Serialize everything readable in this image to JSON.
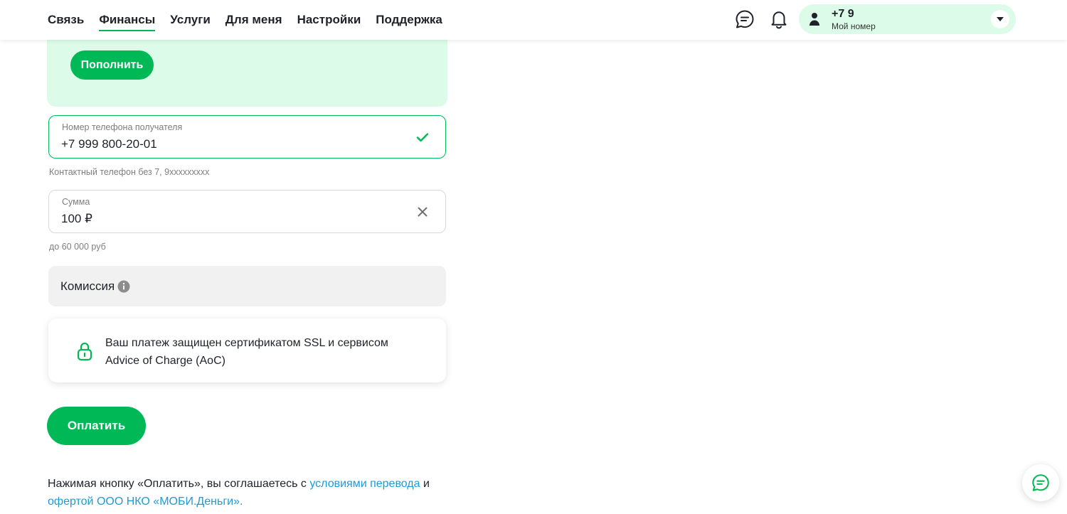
{
  "nav": {
    "items": [
      {
        "label": "Связь"
      },
      {
        "label": "Финансы",
        "active": true
      },
      {
        "label": "Услуги"
      },
      {
        "label": "Для меня"
      },
      {
        "label": "Настройки"
      },
      {
        "label": "Поддержка"
      }
    ],
    "icons": [
      "chat-icon",
      "bell-icon"
    ]
  },
  "account": {
    "number": "+7 9",
    "label": "Мой номер"
  },
  "topup": {
    "button_label": "Пополнить"
  },
  "phone_field": {
    "label": "Номер телефона получателя",
    "value": "+7 999 800-20-01",
    "status_icon": "check-icon",
    "hint": "Контактный телефон без 7, 9xxxxxxxxx"
  },
  "amount_field": {
    "label": "Сумма",
    "value": "100 ₽",
    "clear_icon": "close-icon",
    "hint": "до 60 000 руб"
  },
  "commission": {
    "label": "Комиссия",
    "icon": "info-icon"
  },
  "security": {
    "icon": "lock-icon",
    "text": "Ваш платеж защищен сертификатом SSL и сервисом Advice of Charge (AoC)"
  },
  "pay": {
    "button_label": "Оплатить"
  },
  "legal": {
    "text_before": "Нажимая кнопку «Оплатить», вы соглашаетесь с ",
    "link1": "условиями перевода",
    "text_middle": " и ",
    "link2": "офертой ООО НКО «МОБИ.Деньги»."
  },
  "colors": {
    "brand_green": "#00b956",
    "light_green": "#ddfbe9",
    "link_blue": "#1d9bd8",
    "text": "#1f2229",
    "muted": "#7e7e7e"
  }
}
